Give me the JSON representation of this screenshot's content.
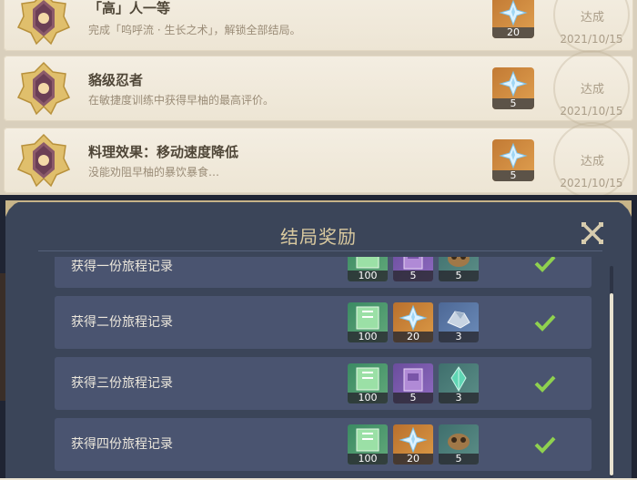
{
  "achievements": [
    {
      "title": "「高」人一等",
      "desc": "完成「呜呼流 · 生长之术」，解锁全部结局。",
      "reward_count": "20",
      "status": "达成",
      "date": "2021/10/15"
    },
    {
      "title": "貉级忍者",
      "desc": "在敏捷度训练中获得早柚的最高评价。",
      "reward_count": "5",
      "status": "达成",
      "date": "2021/10/15"
    },
    {
      "title": "料理效果：移动速度降低",
      "desc": "没能劝阻早柚的暴饮暴食…",
      "reward_count": "5",
      "status": "达成",
      "date": "2021/10/15"
    }
  ],
  "modal": {
    "title": "结局奖励",
    "rows": [
      {
        "label": "获得一份旅程记录",
        "items": [
          {
            "icon": "exp-book-icon",
            "count": "100",
            "color": "green"
          },
          {
            "icon": "purple-book-icon",
            "count": "5",
            "color": "purple"
          },
          {
            "icon": "raccoon-icon",
            "count": "5",
            "color": "teal"
          }
        ]
      },
      {
        "label": "获得二份旅程记录",
        "items": [
          {
            "icon": "exp-book-icon",
            "count": "100",
            "color": "green"
          },
          {
            "icon": "primogem-icon",
            "count": "20",
            "color": "orange"
          },
          {
            "icon": "ore-icon",
            "count": "3",
            "color": "blue"
          }
        ]
      },
      {
        "label": "获得三份旅程记录",
        "items": [
          {
            "icon": "exp-book-icon",
            "count": "100",
            "color": "green"
          },
          {
            "icon": "purple-book-icon",
            "count": "5",
            "color": "purple"
          },
          {
            "icon": "crystal-icon",
            "count": "3",
            "color": "teal"
          }
        ]
      },
      {
        "label": "获得四份旅程记录",
        "items": [
          {
            "icon": "exp-book-icon",
            "count": "100",
            "color": "green"
          },
          {
            "icon": "primogem-icon",
            "count": "20",
            "color": "orange"
          },
          {
            "icon": "raccoon-icon",
            "count": "5",
            "color": "teal"
          }
        ]
      }
    ]
  },
  "colors": {
    "accent_gold": "#d9c99f",
    "check_green": "#8fd14f",
    "panel_bg": "#3b4559",
    "row_bg": "#4a5470"
  }
}
